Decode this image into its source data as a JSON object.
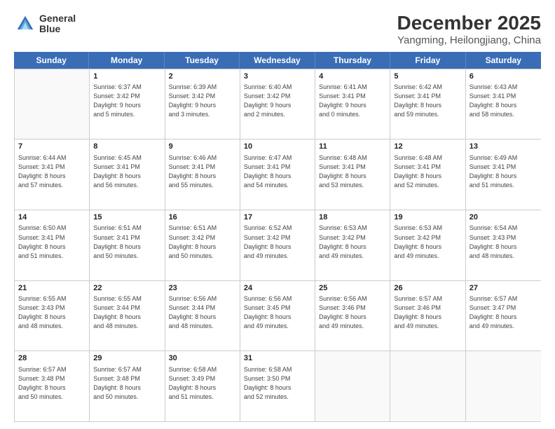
{
  "header": {
    "logo_line1": "General",
    "logo_line2": "Blue",
    "title": "December 2025",
    "subtitle": "Yangming, Heilongjiang, China"
  },
  "days_of_week": [
    "Sunday",
    "Monday",
    "Tuesday",
    "Wednesday",
    "Thursday",
    "Friday",
    "Saturday"
  ],
  "weeks": [
    [
      {
        "day": "",
        "info": ""
      },
      {
        "day": "1",
        "info": "Sunrise: 6:37 AM\nSunset: 3:42 PM\nDaylight: 9 hours\nand 5 minutes."
      },
      {
        "day": "2",
        "info": "Sunrise: 6:39 AM\nSunset: 3:42 PM\nDaylight: 9 hours\nand 3 minutes."
      },
      {
        "day": "3",
        "info": "Sunrise: 6:40 AM\nSunset: 3:42 PM\nDaylight: 9 hours\nand 2 minutes."
      },
      {
        "day": "4",
        "info": "Sunrise: 6:41 AM\nSunset: 3:41 PM\nDaylight: 9 hours\nand 0 minutes."
      },
      {
        "day": "5",
        "info": "Sunrise: 6:42 AM\nSunset: 3:41 PM\nDaylight: 8 hours\nand 59 minutes."
      },
      {
        "day": "6",
        "info": "Sunrise: 6:43 AM\nSunset: 3:41 PM\nDaylight: 8 hours\nand 58 minutes."
      }
    ],
    [
      {
        "day": "7",
        "info": "Sunrise: 6:44 AM\nSunset: 3:41 PM\nDaylight: 8 hours\nand 57 minutes."
      },
      {
        "day": "8",
        "info": "Sunrise: 6:45 AM\nSunset: 3:41 PM\nDaylight: 8 hours\nand 56 minutes."
      },
      {
        "day": "9",
        "info": "Sunrise: 6:46 AM\nSunset: 3:41 PM\nDaylight: 8 hours\nand 55 minutes."
      },
      {
        "day": "10",
        "info": "Sunrise: 6:47 AM\nSunset: 3:41 PM\nDaylight: 8 hours\nand 54 minutes."
      },
      {
        "day": "11",
        "info": "Sunrise: 6:48 AM\nSunset: 3:41 PM\nDaylight: 8 hours\nand 53 minutes."
      },
      {
        "day": "12",
        "info": "Sunrise: 6:48 AM\nSunset: 3:41 PM\nDaylight: 8 hours\nand 52 minutes."
      },
      {
        "day": "13",
        "info": "Sunrise: 6:49 AM\nSunset: 3:41 PM\nDaylight: 8 hours\nand 51 minutes."
      }
    ],
    [
      {
        "day": "14",
        "info": "Sunrise: 6:50 AM\nSunset: 3:41 PM\nDaylight: 8 hours\nand 51 minutes."
      },
      {
        "day": "15",
        "info": "Sunrise: 6:51 AM\nSunset: 3:41 PM\nDaylight: 8 hours\nand 50 minutes."
      },
      {
        "day": "16",
        "info": "Sunrise: 6:51 AM\nSunset: 3:42 PM\nDaylight: 8 hours\nand 50 minutes."
      },
      {
        "day": "17",
        "info": "Sunrise: 6:52 AM\nSunset: 3:42 PM\nDaylight: 8 hours\nand 49 minutes."
      },
      {
        "day": "18",
        "info": "Sunrise: 6:53 AM\nSunset: 3:42 PM\nDaylight: 8 hours\nand 49 minutes."
      },
      {
        "day": "19",
        "info": "Sunrise: 6:53 AM\nSunset: 3:42 PM\nDaylight: 8 hours\nand 49 minutes."
      },
      {
        "day": "20",
        "info": "Sunrise: 6:54 AM\nSunset: 3:43 PM\nDaylight: 8 hours\nand 48 minutes."
      }
    ],
    [
      {
        "day": "21",
        "info": "Sunrise: 6:55 AM\nSunset: 3:43 PM\nDaylight: 8 hours\nand 48 minutes."
      },
      {
        "day": "22",
        "info": "Sunrise: 6:55 AM\nSunset: 3:44 PM\nDaylight: 8 hours\nand 48 minutes."
      },
      {
        "day": "23",
        "info": "Sunrise: 6:56 AM\nSunset: 3:44 PM\nDaylight: 8 hours\nand 48 minutes."
      },
      {
        "day": "24",
        "info": "Sunrise: 6:56 AM\nSunset: 3:45 PM\nDaylight: 8 hours\nand 49 minutes."
      },
      {
        "day": "25",
        "info": "Sunrise: 6:56 AM\nSunset: 3:46 PM\nDaylight: 8 hours\nand 49 minutes."
      },
      {
        "day": "26",
        "info": "Sunrise: 6:57 AM\nSunset: 3:46 PM\nDaylight: 8 hours\nand 49 minutes."
      },
      {
        "day": "27",
        "info": "Sunrise: 6:57 AM\nSunset: 3:47 PM\nDaylight: 8 hours\nand 49 minutes."
      }
    ],
    [
      {
        "day": "28",
        "info": "Sunrise: 6:57 AM\nSunset: 3:48 PM\nDaylight: 8 hours\nand 50 minutes."
      },
      {
        "day": "29",
        "info": "Sunrise: 6:57 AM\nSunset: 3:48 PM\nDaylight: 8 hours\nand 50 minutes."
      },
      {
        "day": "30",
        "info": "Sunrise: 6:58 AM\nSunset: 3:49 PM\nDaylight: 8 hours\nand 51 minutes."
      },
      {
        "day": "31",
        "info": "Sunrise: 6:58 AM\nSunset: 3:50 PM\nDaylight: 8 hours\nand 52 minutes."
      },
      {
        "day": "",
        "info": ""
      },
      {
        "day": "",
        "info": ""
      },
      {
        "day": "",
        "info": ""
      }
    ]
  ]
}
